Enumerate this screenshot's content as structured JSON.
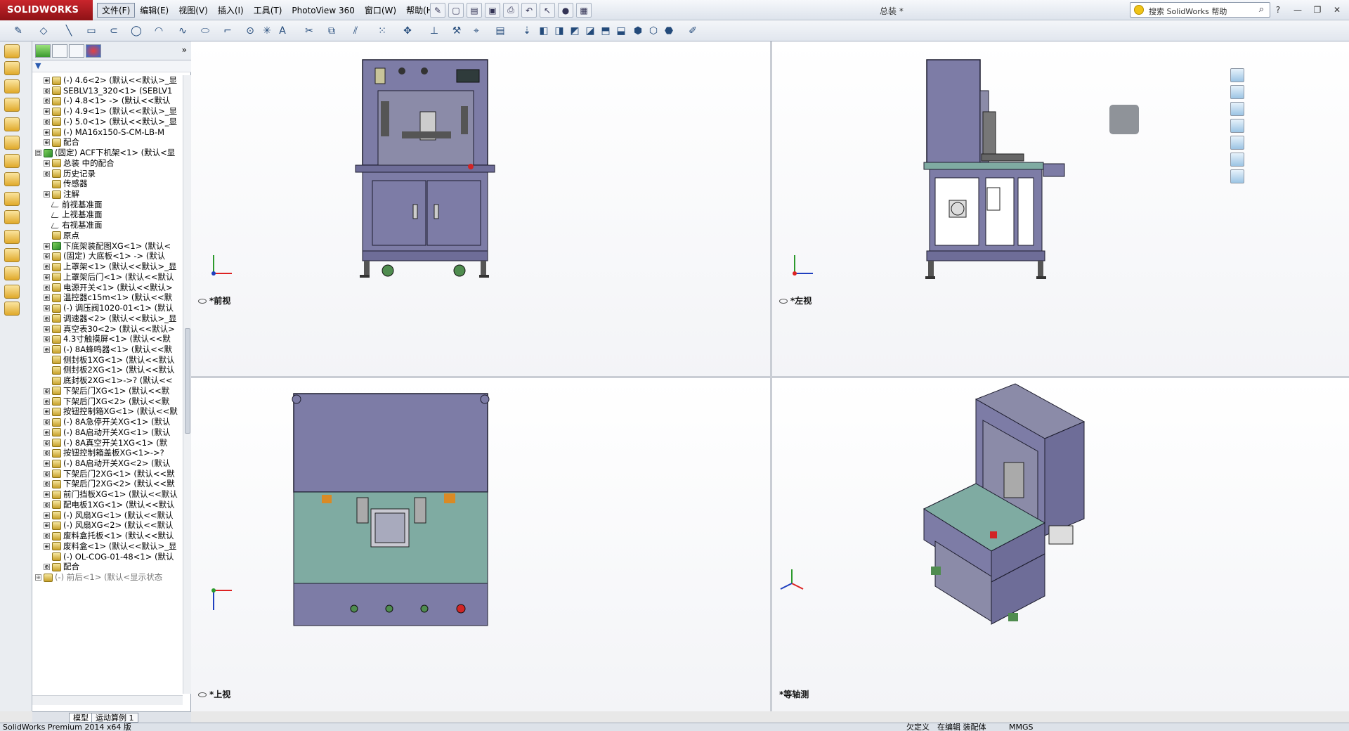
{
  "app": {
    "logo": "SOLIDWORKS",
    "doc_title": "总装 *"
  },
  "menu": [
    "文件(F)",
    "编辑(E)",
    "视图(V)",
    "插入(I)",
    "工具(T)",
    "PhotoView 360",
    "窗口(W)",
    "帮助(H)"
  ],
  "search": {
    "placeholder": "搜索 SolidWorks 帮助"
  },
  "window_buttons": [
    "?",
    "—",
    "❐",
    "✕"
  ],
  "tree": {
    "rows": [
      {
        "indent": 1,
        "tog": "⊕",
        "icon": "part",
        "text": "(-) 4.6<2> (默认<<默认>_显"
      },
      {
        "indent": 1,
        "tog": "⊕",
        "icon": "part",
        "text": "SEBLV13_320<1> (SEBLV1"
      },
      {
        "indent": 1,
        "tog": "⊕",
        "icon": "part",
        "text": "(-) 4.8<1> -> (默认<<默认"
      },
      {
        "indent": 1,
        "tog": "⊕",
        "icon": "part",
        "text": "(-) 4.9<1> (默认<<默认>_显"
      },
      {
        "indent": 1,
        "tog": "⊕",
        "icon": "part",
        "text": "(-) 5.0<1> (默认<<默认>_显"
      },
      {
        "indent": 1,
        "tog": "⊕",
        "icon": "part",
        "text": "(-) MA16x150-S-CM-LB-M"
      },
      {
        "indent": 1,
        "tog": "⊕",
        "icon": "mate",
        "text": "配合"
      },
      {
        "indent": 0,
        "tog": "⊟",
        "icon": "asm",
        "text": "(固定) ACF下机架<1> (默认<显"
      },
      {
        "indent": 1,
        "tog": "⊕",
        "icon": "part",
        "text": "总装 中的配合"
      },
      {
        "indent": 1,
        "tog": "⊕",
        "icon": "part",
        "text": "历史记录"
      },
      {
        "indent": 1,
        "tog": "",
        "icon": "part",
        "text": "传感器"
      },
      {
        "indent": 1,
        "tog": "⊕",
        "icon": "part",
        "text": "注解"
      },
      {
        "indent": 1,
        "tog": "",
        "icon": "plane",
        "text": "前视基准面"
      },
      {
        "indent": 1,
        "tog": "",
        "icon": "plane",
        "text": "上视基准面"
      },
      {
        "indent": 1,
        "tog": "",
        "icon": "plane",
        "text": "右视基准面"
      },
      {
        "indent": 1,
        "tog": "",
        "icon": "origin",
        "text": "原点"
      },
      {
        "indent": 1,
        "tog": "⊕",
        "icon": "asm",
        "text": "下底架装配图XG<1> (默认<"
      },
      {
        "indent": 1,
        "tog": "⊕",
        "icon": "part",
        "text": "(固定) 大底板<1> -> (默认"
      },
      {
        "indent": 1,
        "tog": "⊕",
        "icon": "part",
        "text": "上罩架<1> (默认<<默认>_显"
      },
      {
        "indent": 1,
        "tog": "⊕",
        "icon": "part",
        "text": "上罩架后门<1> (默认<<默认"
      },
      {
        "indent": 1,
        "tog": "⊕",
        "icon": "part",
        "text": "电源开关<1> (默认<<默认>"
      },
      {
        "indent": 1,
        "tog": "⊕",
        "icon": "part",
        "text": "温控器c15m<1> (默认<<默"
      },
      {
        "indent": 1,
        "tog": "⊕",
        "icon": "part",
        "text": "(-) 调压阀1020-01<1> (默认"
      },
      {
        "indent": 1,
        "tog": "⊕",
        "icon": "part",
        "text": "调速器<2> (默认<<默认>_显"
      },
      {
        "indent": 1,
        "tog": "⊕",
        "icon": "part",
        "text": "真空表30<2> (默认<<默认>"
      },
      {
        "indent": 1,
        "tog": "⊕",
        "icon": "part",
        "text": "4.3寸触摸屏<1> (默认<<默"
      },
      {
        "indent": 1,
        "tog": "⊕",
        "icon": "part",
        "text": "(-) 8A蜂鸣器<1> (默认<<默"
      },
      {
        "indent": 1,
        "tog": "",
        "icon": "part",
        "text": "侧封板1XG<1> (默认<<默认"
      },
      {
        "indent": 1,
        "tog": "",
        "icon": "part",
        "text": "侧封板2XG<1> (默认<<默认"
      },
      {
        "indent": 1,
        "tog": "",
        "icon": "part",
        "text": "底封板2XG<1>->? (默认<<"
      },
      {
        "indent": 1,
        "tog": "⊕",
        "icon": "part",
        "text": "下架后门XG<1> (默认<<默"
      },
      {
        "indent": 1,
        "tog": "⊕",
        "icon": "part",
        "text": "下架后门XG<2> (默认<<默"
      },
      {
        "indent": 1,
        "tog": "⊕",
        "icon": "part",
        "text": "按钮控制箱XG<1> (默认<<默"
      },
      {
        "indent": 1,
        "tog": "⊕",
        "icon": "part",
        "text": "(-) 8A急停开关XG<1> (默认"
      },
      {
        "indent": 1,
        "tog": "⊕",
        "icon": "part",
        "text": "(-) 8A启动开关XG<1> (默认"
      },
      {
        "indent": 1,
        "tog": "⊕",
        "icon": "part",
        "text": "(-) 8A真空开关1XG<1> (默"
      },
      {
        "indent": 1,
        "tog": "⊕",
        "icon": "part",
        "text": "按钮控制箱盖板XG<1>->?"
      },
      {
        "indent": 1,
        "tog": "⊕",
        "icon": "part",
        "text": "(-) 8A启动开关XG<2> (默认"
      },
      {
        "indent": 1,
        "tog": "⊕",
        "icon": "part",
        "text": "下架后门2XG<1> (默认<<默"
      },
      {
        "indent": 1,
        "tog": "⊕",
        "icon": "part",
        "text": "下架后门2XG<2> (默认<<默"
      },
      {
        "indent": 1,
        "tog": "⊕",
        "icon": "part",
        "text": "前门挡板XG<1> (默认<<默认"
      },
      {
        "indent": 1,
        "tog": "⊕",
        "icon": "part",
        "text": "配电板1XG<1> (默认<<默认"
      },
      {
        "indent": 1,
        "tog": "⊕",
        "icon": "part",
        "text": "(-) 风扇XG<1> (默认<<默认"
      },
      {
        "indent": 1,
        "tog": "⊕",
        "icon": "part",
        "text": "(-) 风扇XG<2> (默认<<默认"
      },
      {
        "indent": 1,
        "tog": "⊕",
        "icon": "part",
        "text": "废料盒托板<1> (默认<<默认"
      },
      {
        "indent": 1,
        "tog": "⊕",
        "icon": "part",
        "text": "废料盒<1> (默认<<默认>_显"
      },
      {
        "indent": 1,
        "tog": "",
        "icon": "part",
        "text": "(-) OL-COG-01-48<1> (默认"
      },
      {
        "indent": 1,
        "tog": "⊕",
        "icon": "mate",
        "text": "配合"
      },
      {
        "indent": 0,
        "tog": "⊕",
        "icon": "warn",
        "text": "(-) 前后<1> (默认<显示状态"
      }
    ]
  },
  "bottom_tabs": [
    "模型",
    "运动算例 1"
  ],
  "views": {
    "front": "*前视",
    "left": "*左视",
    "top": "*上视",
    "iso": "*等轴测"
  },
  "status": {
    "version": "SolidWorks Premium 2014 x64 版",
    "undef": "欠定义",
    "editing": "在编辑 装配体",
    "units": "MMGS"
  },
  "colors": {
    "machine": "#7d7ca6",
    "panel": "#8b8ba8",
    "table": "#7faba2",
    "outline": "#1d1d2e"
  }
}
